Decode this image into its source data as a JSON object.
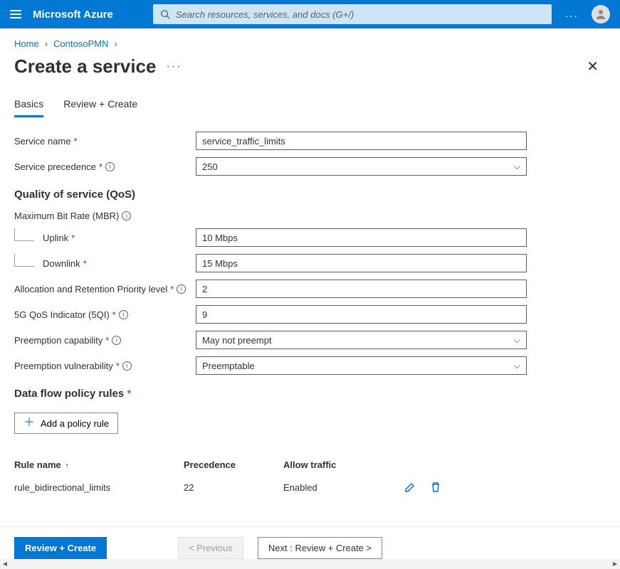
{
  "topbar": {
    "brand": "Microsoft Azure",
    "search_placeholder": "Search resources, services, and docs (G+/)",
    "more": "..."
  },
  "breadcrumb": {
    "items": [
      "Home",
      "ContosoPMN"
    ]
  },
  "page": {
    "title": "Create a service"
  },
  "tabs": {
    "items": [
      {
        "label": "Basics"
      },
      {
        "label": "Review + Create"
      }
    ]
  },
  "form": {
    "service_name_label": "Service name",
    "service_name_value": "service_traffic_limits",
    "service_precedence_label": "Service precedence",
    "service_precedence_value": "250",
    "qos_header": "Quality of service (QoS)",
    "mbr_label": "Maximum Bit Rate (MBR)",
    "uplink_label": "Uplink",
    "uplink_value": "10 Mbps",
    "downlink_label": "Downlink",
    "downlink_value": "15 Mbps",
    "arp_label": "Allocation and Retention Priority level",
    "arp_value": "2",
    "fiveqi_label": "5G QoS Indicator (5QI)",
    "fiveqi_value": "9",
    "preempt_cap_label": "Preemption capability",
    "preempt_cap_value": "May not preempt",
    "preempt_vuln_label": "Preemption vulnerability",
    "preempt_vuln_value": "Preemptable",
    "rules_header": "Data flow policy rules",
    "add_rule_label": "Add a policy rule"
  },
  "table": {
    "headers": {
      "name": "Rule name",
      "precedence": "Precedence",
      "allow": "Allow traffic"
    },
    "rows": [
      {
        "name": "rule_bidirectional_limits",
        "precedence": "22",
        "allow": "Enabled"
      }
    ]
  },
  "footer": {
    "review": "Review + Create",
    "previous": "< Previous",
    "next": "Next : Review + Create >"
  }
}
